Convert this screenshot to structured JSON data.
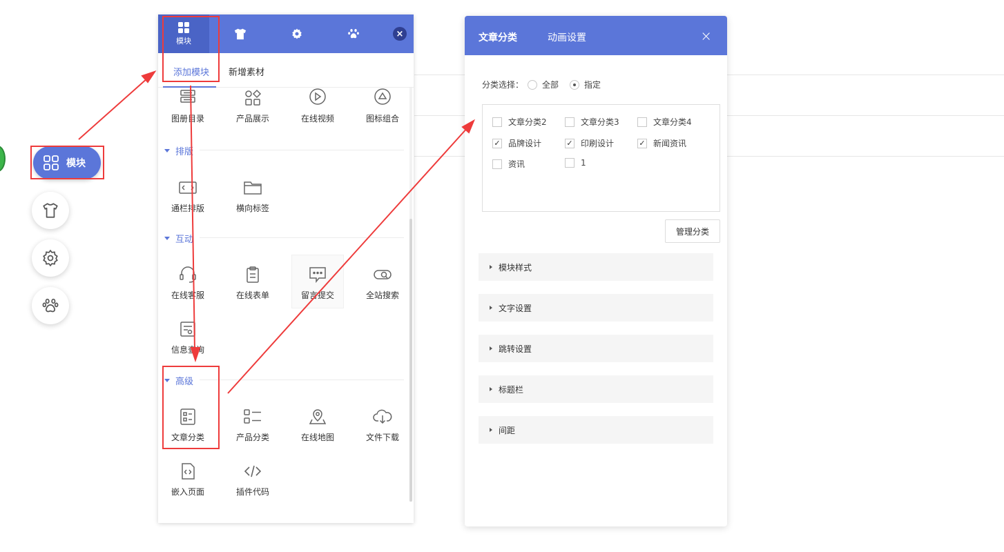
{
  "dock": {
    "main_label": "模块",
    "buttons": [
      "shirt-icon",
      "gear-icon",
      "paw-icon"
    ]
  },
  "module_panel": {
    "tabs": [
      {
        "icon": "grid-icon",
        "label": "模块"
      },
      {
        "icon": "shirt-icon",
        "label": ""
      },
      {
        "icon": "gear-icon",
        "label": ""
      },
      {
        "icon": "paw-icon",
        "label": ""
      }
    ],
    "close": "×",
    "subtabs": {
      "add": "添加模块",
      "material": "新增素材"
    },
    "top_items": [
      "图册目录",
      "产品展示",
      "在线视频",
      "图标组合"
    ],
    "sections": [
      {
        "title": "排版",
        "items": [
          "通栏排版",
          "横向标签"
        ]
      },
      {
        "title": "互动",
        "items": [
          "在线客服",
          "在线表单",
          "留言提交",
          "全站搜索",
          "信息查询"
        ]
      },
      {
        "title": "高级",
        "items": [
          "文章分类",
          "产品分类",
          "在线地图",
          "文件下载",
          "嵌入页面",
          "插件代码"
        ]
      }
    ]
  },
  "settings_panel": {
    "tabs": [
      "文章分类",
      "动画设置"
    ],
    "close": "×",
    "category_select": {
      "label": "分类选择：",
      "options": [
        "全部",
        "指定"
      ],
      "selected": "指定"
    },
    "categories": [
      {
        "name": "文章分类2",
        "checked": false,
        "mark": ""
      },
      {
        "name": "文章分类3",
        "checked": false,
        "mark": ""
      },
      {
        "name": "文章分类4",
        "checked": false,
        "mark": ""
      },
      {
        "name": "品牌设计",
        "checked": true,
        "mark": "✓"
      },
      {
        "name": "印刷设计",
        "checked": true,
        "mark": "✓"
      },
      {
        "name": "新闻资讯",
        "checked": true,
        "mark": "✓"
      },
      {
        "name": "资讯",
        "checked": false,
        "mark": ""
      },
      {
        "name": "1",
        "checked": false,
        "mark": ""
      }
    ],
    "manage_button": "管理分类",
    "accordions": [
      "模块样式",
      "文字设置",
      "跳转设置",
      "标题栏",
      "间距"
    ]
  },
  "colors": {
    "primary": "#5b76d9",
    "highlight": "#ee3b3b"
  }
}
